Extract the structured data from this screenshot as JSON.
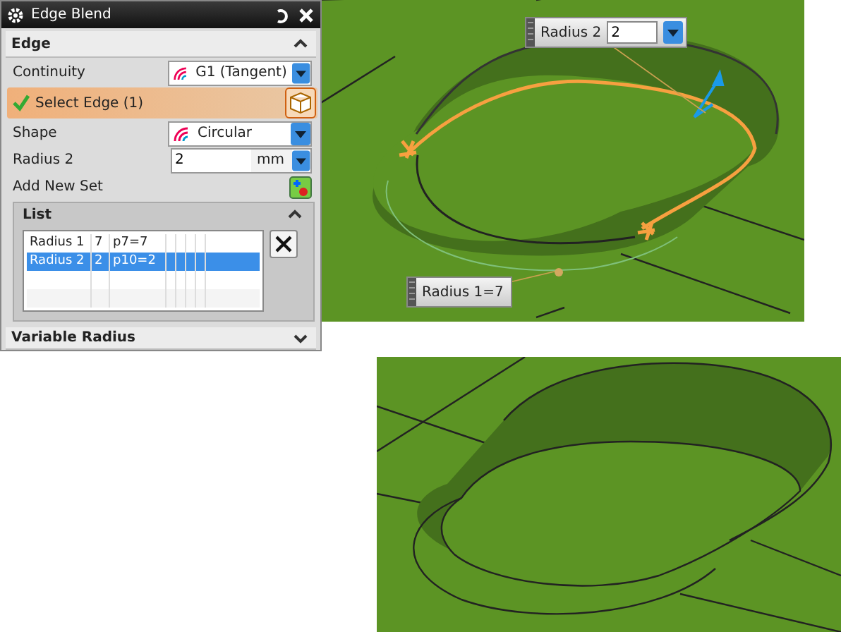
{
  "dialog": {
    "title": "Edge Blend",
    "edge_section": {
      "title": "Edge",
      "expanded": true,
      "continuity": {
        "label": "Continuity",
        "value": "G1 (Tangent)"
      },
      "select_edge": {
        "label": "Select Edge (1)",
        "done": true
      },
      "shape": {
        "label": "Shape",
        "value": "Circular"
      },
      "radius": {
        "label": "Radius 2",
        "value": "2",
        "unit": "mm"
      },
      "add_new_set": {
        "label": "Add New Set"
      }
    },
    "list": {
      "title": "List",
      "expanded": true,
      "rows": [
        {
          "cells": [
            "Radius 1",
            "7",
            "p7=7"
          ],
          "selected": false
        },
        {
          "cells": [
            "Radius 2",
            "2",
            "p10=2"
          ],
          "selected": true
        }
      ]
    },
    "next_section": {
      "title": "Variable Radius",
      "expanded": false
    }
  },
  "viewport": {
    "radius_field": {
      "label": "Radius 2",
      "value": "2"
    },
    "radius_label": {
      "label": "Radius 1=7"
    }
  }
}
